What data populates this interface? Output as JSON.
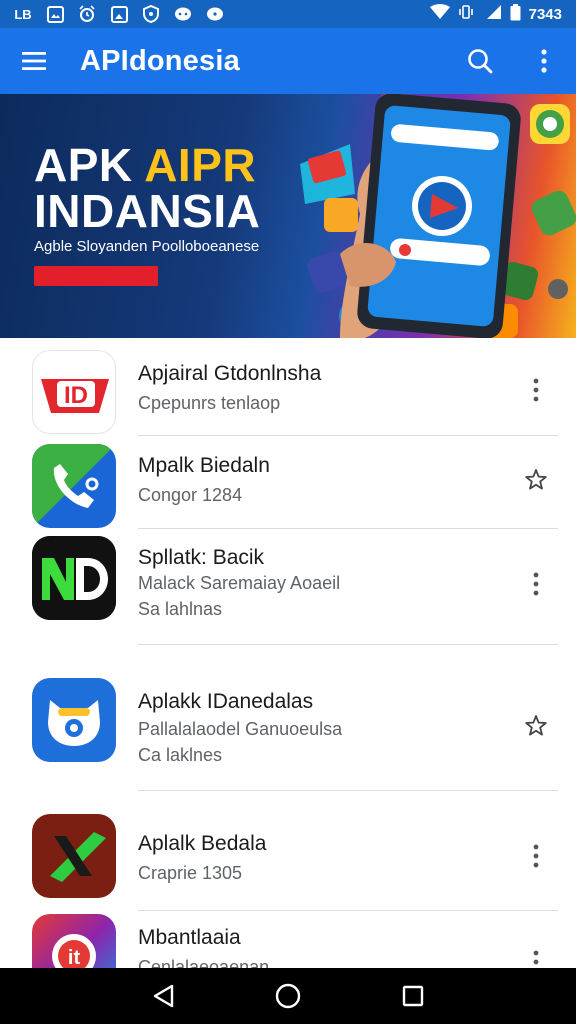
{
  "status_bar": {
    "left_icons": [
      "lb-icon",
      "image-icon",
      "alarm-icon",
      "gallery-icon",
      "shield-icon",
      "message-icon",
      "chat-icon"
    ],
    "left_labels": [
      "LB"
    ],
    "time": "7343"
  },
  "app_bar": {
    "title": "APIdonesia"
  },
  "banner": {
    "title_line1_a": "APK ",
    "title_line1_b": "AIPR",
    "title_line2": "INDANSIA",
    "subtitle": "Agble Sloyanden Poolloboeanese",
    "cta_color": "#e21f2a"
  },
  "apps": [
    {
      "name": "Apjairal Gtdonlnsha",
      "sub1": "Cpepunrs tenlaop",
      "sub2": "",
      "action": "more",
      "icon": "id-badge-icon",
      "icon_text": "ID"
    },
    {
      "name": "Mpalk Biedaln",
      "sub1": "Congor 1284",
      "sub2": "",
      "action": "star",
      "icon": "phone-app-icon",
      "icon_text": ""
    },
    {
      "name": "Spllatk: Bacik",
      "sub1": "Malack Saremaiay Aoaeil",
      "sub2": "Sa lahlnas",
      "action": "more",
      "icon": "nd-logo-icon",
      "icon_text": "ND"
    },
    {
      "name": "Aplakk IDanedalas",
      "sub1": "Pallalalaodel Ganuoeulsa",
      "sub2": "Ca laklnes",
      "action": "star",
      "icon": "cat-eye-icon",
      "icon_text": ""
    },
    {
      "name": "Aplalk Bedala",
      "sub1": "Craprie 1305",
      "sub2": "",
      "action": "more",
      "icon": "x-logo-icon",
      "icon_text": "X"
    },
    {
      "name": "Mbantlaaia",
      "sub1": "Cenlalaeoaenan",
      "sub2": "",
      "action": "more",
      "icon": "it-logo-icon",
      "icon_text": "it"
    }
  ],
  "colors": {
    "status_bar": "#1565c0",
    "app_bar": "#1a73e8",
    "nav_bar": "#000000"
  }
}
